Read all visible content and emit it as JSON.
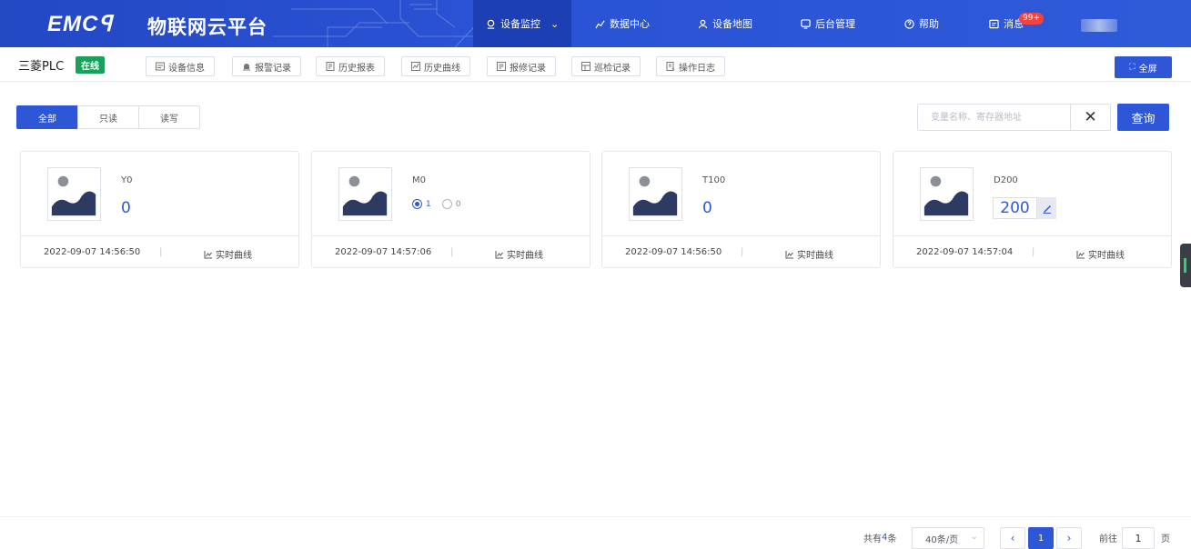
{
  "brand": {
    "logo": "EMCꟼ",
    "title": "物联网云平台"
  },
  "nav": {
    "items": [
      {
        "label": "设备监控",
        "icon": "monitor-icon"
      },
      {
        "label": "数据中心",
        "icon": "chart-icon"
      },
      {
        "label": "设备地图",
        "icon": "map-icon"
      },
      {
        "label": "后台管理",
        "icon": "admin-icon"
      },
      {
        "label": "帮助",
        "icon": "help-icon"
      },
      {
        "label": "消息",
        "icon": "message-icon"
      }
    ],
    "message_badge": "99+"
  },
  "device": {
    "name": "三菱PLC",
    "status": "在线"
  },
  "tools": [
    "设备信息",
    "报警记录",
    "历史报表",
    "历史曲线",
    "报修记录",
    "巡检记录",
    "操作日志"
  ],
  "fullscreen_label": "全屏",
  "filter": {
    "tabs": [
      "全部",
      "只读",
      "读写"
    ],
    "active": "全部"
  },
  "search": {
    "placeholder": "变量名称、寄存器地址",
    "value": "",
    "clear": "✕",
    "button": "查询"
  },
  "cards": [
    {
      "name": "Y0",
      "value": "0",
      "timestamp": "2022-09-07 14:56:50",
      "curve_label": "实时曲线"
    },
    {
      "name": "M0",
      "radio": [
        "1",
        "0"
      ],
      "selected": "1",
      "timestamp": "2022-09-07 14:57:06",
      "curve_label": "实时曲线"
    },
    {
      "name": "T100",
      "value": "0",
      "timestamp": "2022-09-07 14:56:50",
      "curve_label": "实时曲线"
    },
    {
      "name": "D200",
      "value": "200",
      "timestamp": "2022-09-07 14:57:04",
      "curve_label": "实时曲线"
    }
  ],
  "pagination": {
    "total_prefix": "共有",
    "total": "4",
    "total_suffix": "条",
    "page_size": "40条/页",
    "current": "1",
    "goto_label": "前往",
    "goto_value": "1",
    "page_suffix": "页"
  },
  "colors": {
    "nav_bg": "#2a52d4",
    "primary": "#2d57d6",
    "online": "#19a15b",
    "badge": "#f0463f"
  }
}
